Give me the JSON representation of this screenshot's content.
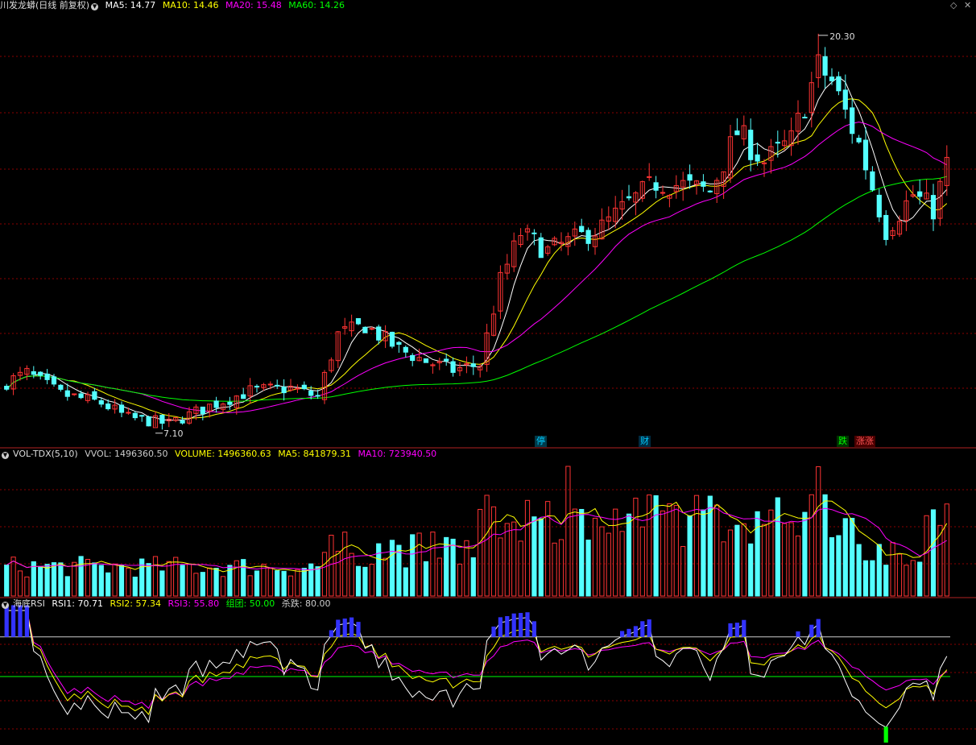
{
  "panels": {
    "price": {
      "name": "川发龙蟒(日线 前复权)",
      "indicators": [
        {
          "label": "MA5: 14.77",
          "color": "#ffffff"
        },
        {
          "label": "MA10: 14.46",
          "color": "#ffff00"
        },
        {
          "label": "MA20: 15.48",
          "color": "#ff00ff"
        },
        {
          "label": "MA60: 14.26",
          "color": "#00ff00"
        }
      ],
      "high_label": "20.30",
      "low_label": "7.10"
    },
    "volume": {
      "name": "VOL-TDX(5,10)",
      "indicators": [
        {
          "label": "VVOL: 1496360.50",
          "color": "#cccccc"
        },
        {
          "label": "VOLUME: 1496360.63",
          "color": "#ffff00"
        },
        {
          "label": "MA5: 841879.31",
          "color": "#ffff00"
        },
        {
          "label": "MA10: 723940.50",
          "color": "#ff00ff"
        }
      ]
    },
    "rsi": {
      "name": "海底RSI",
      "indicators": [
        {
          "label": "RSI1: 70.71",
          "color": "#ffffff"
        },
        {
          "label": "RSI2: 57.34",
          "color": "#ffff00"
        },
        {
          "label": "RSI3: 55.80",
          "color": "#ff00ff"
        },
        {
          "label": "组团: 50.00",
          "color": "#00ff00"
        },
        {
          "label": "杀跌: 80.00",
          "color": "#cccccc"
        }
      ]
    }
  },
  "markers": [
    {
      "label": "停",
      "color": "#00ccff",
      "bg": "#003a4a"
    },
    {
      "label": "财",
      "color": "#00ccff",
      "bg": "#002a40"
    },
    {
      "label": "跌",
      "color": "#00ff00",
      "bg": "#003300"
    },
    {
      "label": "涨涨",
      "color": "#ff5555",
      "bg": "#4a0000"
    }
  ],
  "corner_icons": [
    "diamond-icon",
    "close-icon"
  ],
  "colors": {
    "up": "#ff3333",
    "down": "#54ffff",
    "grid": "#8b0000"
  },
  "chart_data": {
    "type": "candlestick",
    "count": 140,
    "ohlc_anchors": [
      {
        "i": 0,
        "close": 8.6
      },
      {
        "i": 3,
        "close": 8.9
      },
      {
        "i": 8,
        "close": 8.2
      },
      {
        "i": 14,
        "close": 7.9
      },
      {
        "i": 18,
        "close": 7.4
      },
      {
        "i": 24,
        "close": 7.2
      },
      {
        "i": 30,
        "close": 7.8
      },
      {
        "i": 36,
        "close": 8.3
      },
      {
        "i": 42,
        "close": 8.4
      },
      {
        "i": 46,
        "close": 8.1
      },
      {
        "i": 49,
        "close": 10.2
      },
      {
        "i": 53,
        "close": 10.5
      },
      {
        "i": 58,
        "close": 9.7
      },
      {
        "i": 62,
        "close": 9.3
      },
      {
        "i": 66,
        "close": 9.0
      },
      {
        "i": 70,
        "close": 9.2
      },
      {
        "i": 73,
        "close": 12.0
      },
      {
        "i": 76,
        "close": 13.6
      },
      {
        "i": 80,
        "close": 13.0
      },
      {
        "i": 84,
        "close": 13.4
      },
      {
        "i": 88,
        "close": 13.8
      },
      {
        "i": 92,
        "close": 14.6
      },
      {
        "i": 96,
        "close": 15.3
      },
      {
        "i": 100,
        "close": 15.2
      },
      {
        "i": 104,
        "close": 15.0
      },
      {
        "i": 108,
        "close": 17.0
      },
      {
        "i": 112,
        "close": 16.0
      },
      {
        "i": 116,
        "close": 16.7
      },
      {
        "i": 120,
        "close": 19.2
      },
      {
        "i": 122,
        "close": 18.7
      },
      {
        "i": 126,
        "close": 16.6
      },
      {
        "i": 130,
        "close": 13.7
      },
      {
        "i": 134,
        "close": 14.9
      },
      {
        "i": 137,
        "close": 14.4
      },
      {
        "i": 139,
        "close": 15.9
      }
    ],
    "volume_range": [
      0,
      2200000
    ],
    "rsi_levels": {
      "upper": 80,
      "middle": 50
    },
    "ma_periods": [
      5,
      10,
      20,
      60
    ]
  }
}
